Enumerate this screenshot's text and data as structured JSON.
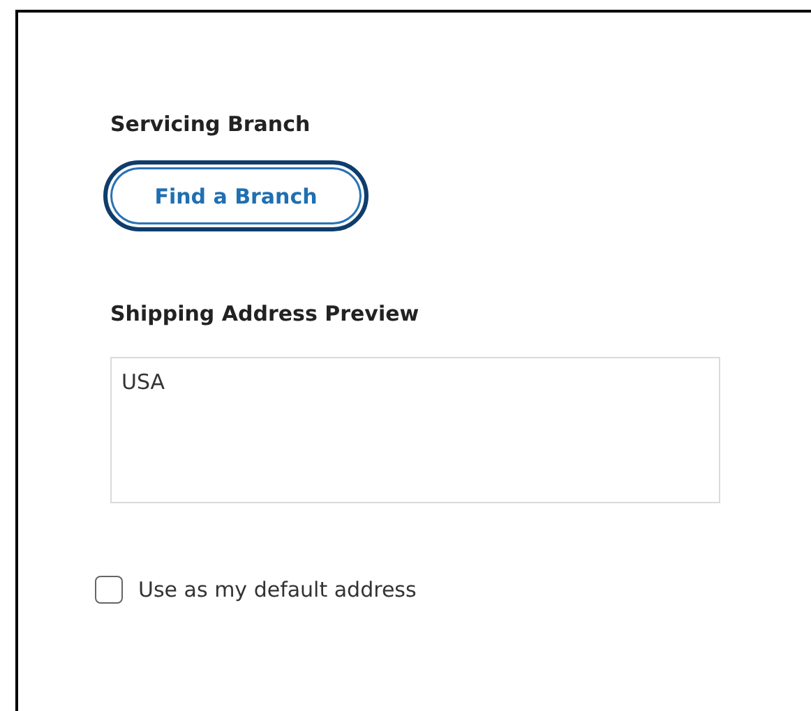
{
  "servicing_branch": {
    "heading": "Servicing Branch",
    "button": {
      "label": "Find a Branch",
      "focused": true
    }
  },
  "shipping_preview": {
    "heading": "Shipping Address Preview",
    "value": "USA"
  },
  "default_address": {
    "label": "Use as my default address",
    "checked": false
  }
}
